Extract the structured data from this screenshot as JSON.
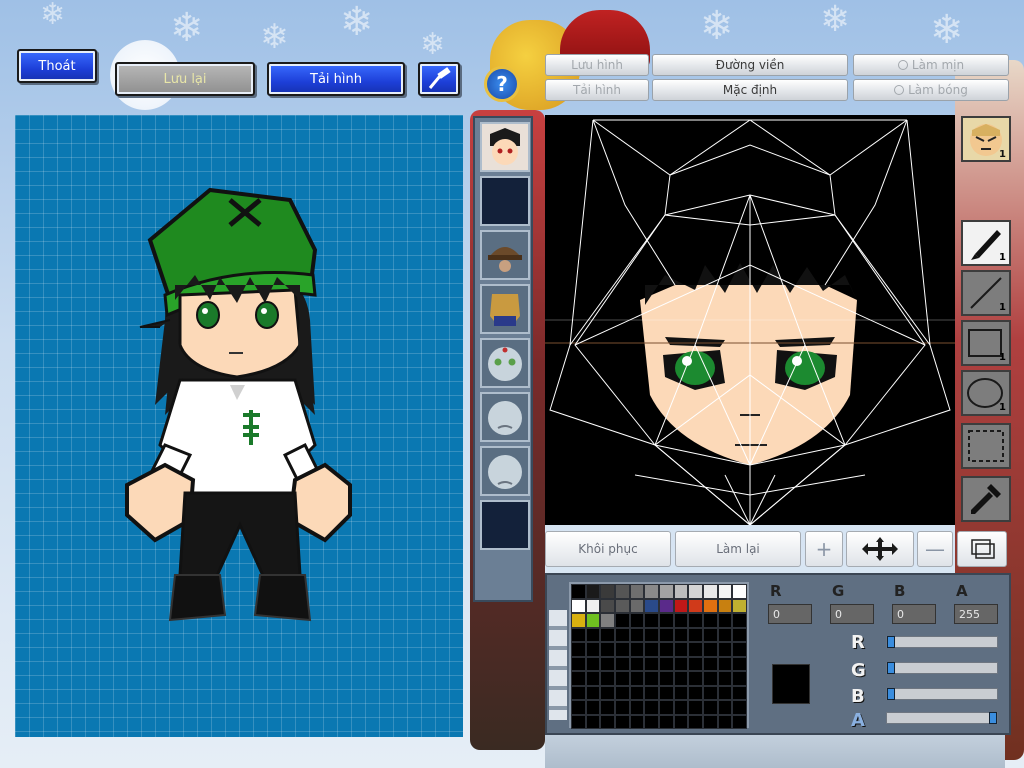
{
  "top_buttons": {
    "exit": "Thoát",
    "save": "Lưu lại",
    "reload": "Tải hình"
  },
  "editor_bars": {
    "save_image": "Lưu hình",
    "load_image": "Tải hình",
    "outline": "Đường viền",
    "default": "Mặc định",
    "smooth": "Làm mịn",
    "shade": "Làm bóng"
  },
  "tools": {
    "pen_count": "1",
    "line_count": "1",
    "rect_count": "1",
    "ellipse_count": "1",
    "avatar_count": "1"
  },
  "lower_buttons": {
    "restore": "Khôi phục",
    "redo": "Làm lại"
  },
  "color": {
    "channels": [
      "R",
      "G",
      "B",
      "A"
    ],
    "r": "0",
    "g": "0",
    "b": "0",
    "a": "255",
    "current_swatch": "#000000",
    "slider_levels": {
      "r": 0,
      "g": 0,
      "b": 0,
      "a": 1.0
    },
    "palette_row1": [
      "#000000",
      "#1a1a1a",
      "#3a3a3a",
      "#555555",
      "#6f6f6f",
      "#8a8a8a",
      "#a3a3a3",
      "#bdbdbd",
      "#d5d5d5",
      "#e8e8e8",
      "#f4f4f4",
      "#ffffff"
    ],
    "palette_row2": [
      "#ffffff",
      "#f0f0f0",
      "#4a4a4a",
      "#5a5a5a",
      "#6a6a6a",
      "#2a4a8a",
      "#5a2a8a",
      "#c01818",
      "#d03a1a",
      "#e07010",
      "#c88010",
      "#c0b030"
    ],
    "palette_row3": [
      "#d8b010",
      "#70c020",
      "#808080"
    ]
  }
}
